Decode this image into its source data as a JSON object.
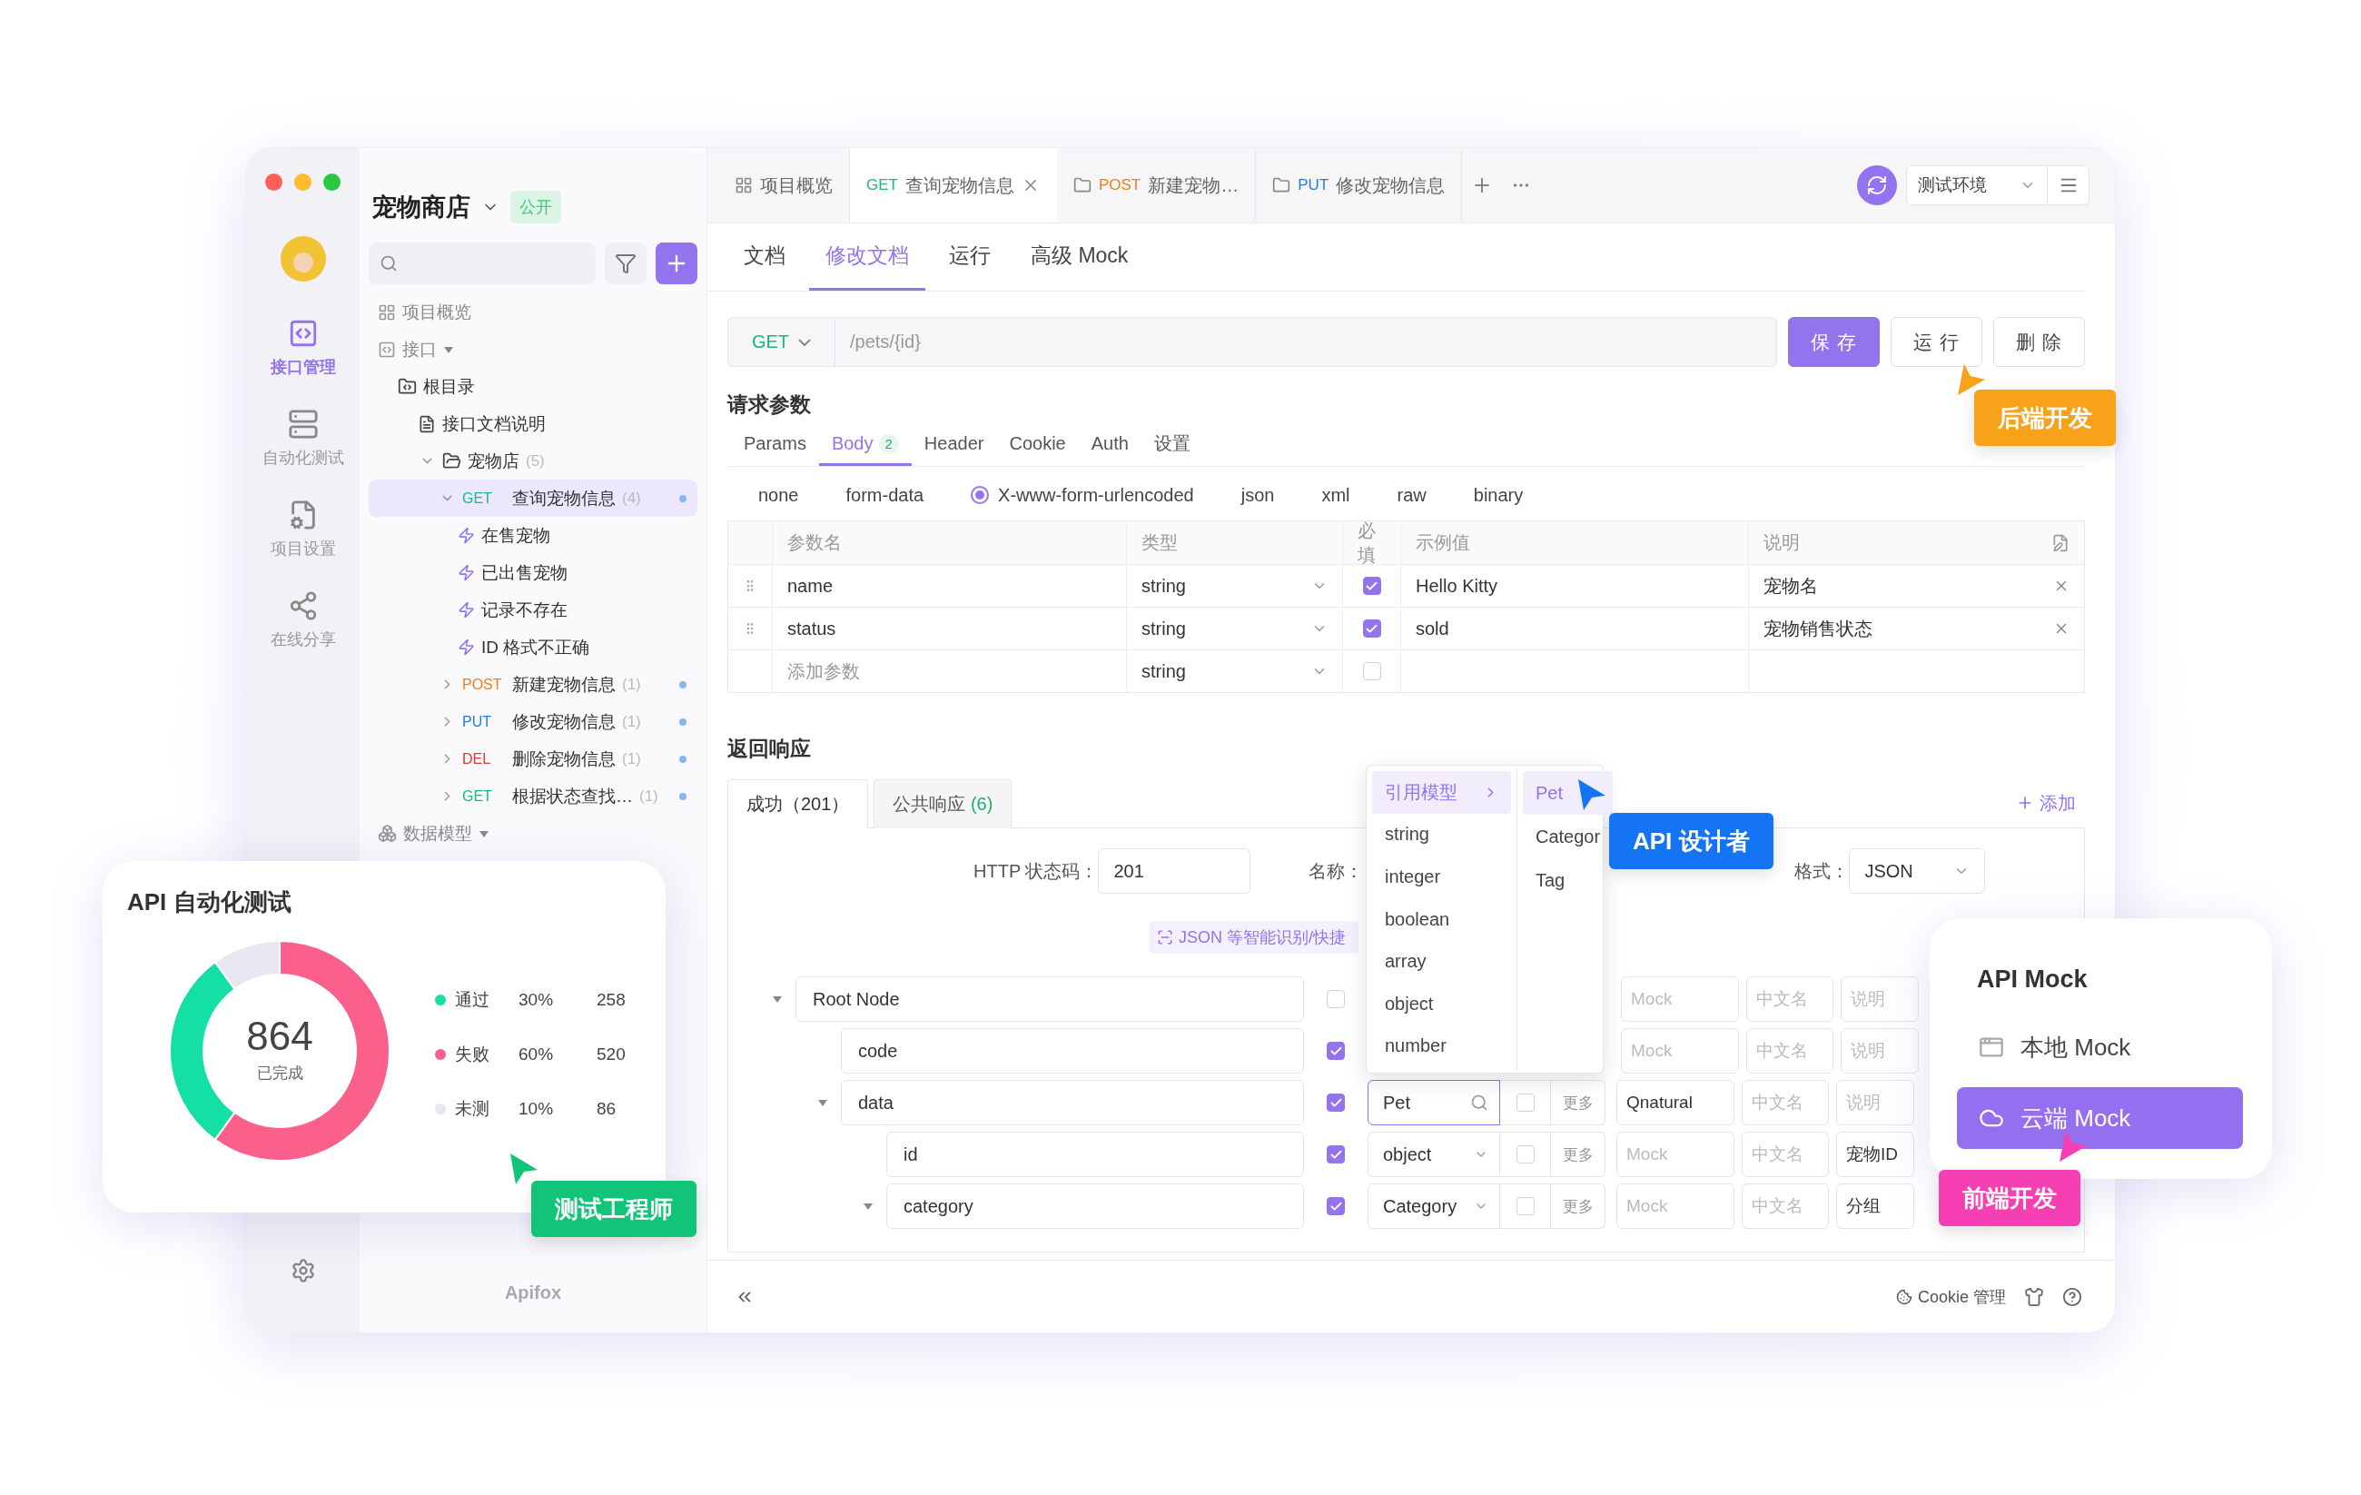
{
  "project": {
    "name": "宠物商店",
    "badge": "公开"
  },
  "rail": [
    {
      "kind": "apis",
      "label": "接口管理",
      "selected": true
    },
    {
      "kind": "automation",
      "label": "自动化测试",
      "selected": false
    },
    {
      "kind": "settings",
      "label": "项目设置",
      "selected": false
    },
    {
      "kind": "share",
      "label": "在线分享",
      "selected": false
    }
  ],
  "tree": [
    {
      "kind": "overview",
      "label": "项目概览"
    },
    {
      "kind": "apis",
      "label": "接口",
      "children": [
        {
          "kind": "root",
          "label": "根目录",
          "children": [
            {
              "kind": "doc",
              "label": "接口文档说明"
            },
            {
              "kind": "folder",
              "label": "宠物店",
              "count": "(5)",
              "expanded": true,
              "children": [
                {
                  "kind": "endpoint",
                  "method": "GET",
                  "color": "#18b97d",
                  "label": "查询宠物信息",
                  "count": "(4)",
                  "expanded": true,
                  "selected": true,
                  "children": [
                    {
                      "kind": "case",
                      "label": "在售宠物"
                    },
                    {
                      "kind": "case",
                      "label": "已出售宠物"
                    },
                    {
                      "kind": "case",
                      "label": "记录不存在"
                    },
                    {
                      "kind": "case",
                      "label": "ID 格式不正确"
                    }
                  ]
                },
                {
                  "kind": "endpoint",
                  "method": "POST",
                  "color": "#f07d1b",
                  "label": "新建宠物信息",
                  "count": "(1)",
                  "expanded": false,
                  "selected": false
                },
                {
                  "kind": "endpoint",
                  "method": "PUT",
                  "color": "#1f7fe0",
                  "label": "修改宠物信息",
                  "count": "(1)",
                  "expanded": false,
                  "selected": false
                },
                {
                  "kind": "endpoint",
                  "method": "DEL",
                  "color": "#e0362c",
                  "label": "删除宠物信息",
                  "count": "(1)",
                  "expanded": false,
                  "selected": false
                },
                {
                  "kind": "endpoint",
                  "method": "GET",
                  "color": "#18b97d",
                  "label": "根据状态查找…",
                  "count": "(1)",
                  "expanded": false,
                  "selected": false
                }
              ]
            }
          ]
        }
      ]
    },
    {
      "kind": "models",
      "label": "数据模型"
    }
  ],
  "footer_logo": "Apifox",
  "tabs": [
    {
      "kind": "overview",
      "label": "项目概览",
      "selected": false
    },
    {
      "kind": "endpoint",
      "method": "GET",
      "color": "#18b97d",
      "label": "查询宠物信息",
      "selected": true
    },
    {
      "kind": "folder",
      "method": "POST",
      "color": "#f07d1b",
      "label": "新建宠物…",
      "selected": false
    },
    {
      "kind": "folder",
      "method": "PUT",
      "color": "#1f7fe0",
      "label": "修改宠物信息",
      "selected": false
    }
  ],
  "environment": "测试环境",
  "doc_tabs": [
    {
      "label": "文档",
      "selected": false
    },
    {
      "label": "修改文档",
      "selected": true
    },
    {
      "label": "运行",
      "selected": false
    },
    {
      "label": "高级 Mock",
      "selected": false
    }
  ],
  "request": {
    "method": "GET",
    "path": "/pets/{id}",
    "buttons": [
      {
        "kind": "primary",
        "label": "保 存"
      },
      {
        "kind": "default",
        "label": "运 行"
      },
      {
        "kind": "default",
        "label": "删 除"
      }
    ]
  },
  "request_params": {
    "title": "请求参数",
    "tabs": [
      {
        "label": "Params",
        "selected": false
      },
      {
        "label": "Body",
        "badge": "2",
        "selected": true
      },
      {
        "label": "Header",
        "selected": false
      },
      {
        "label": "Cookie",
        "selected": false
      },
      {
        "label": "Auth",
        "selected": false
      },
      {
        "label": "设置",
        "selected": false
      }
    ],
    "body_types": [
      {
        "label": "none",
        "selected": false
      },
      {
        "label": "form-data",
        "selected": false
      },
      {
        "label": "X-www-form-urlencoded",
        "selected": true
      },
      {
        "label": "json",
        "selected": false
      },
      {
        "label": "xml",
        "selected": false
      },
      {
        "label": "raw",
        "selected": false
      },
      {
        "label": "binary",
        "selected": false
      }
    ],
    "columns": [
      "参数名",
      "类型",
      "必填",
      "示例值",
      "说明"
    ],
    "rows": [
      {
        "kind": "param",
        "name": "name",
        "type": "string",
        "required": true,
        "example": "Hello Kitty",
        "description": "宠物名"
      },
      {
        "kind": "param",
        "name": "status",
        "type": "string",
        "required": true,
        "example": "sold",
        "description": "宠物销售状态"
      },
      {
        "kind": "new",
        "placeholder": "添加参数",
        "type": "string",
        "required": false
      }
    ]
  },
  "response": {
    "title": "返回响应",
    "tabs": [
      {
        "label": "成功（201）",
        "selected": true
      },
      {
        "label": "公共响应",
        "count": "(6)",
        "selected": false
      }
    ],
    "add": "添加",
    "status_label": "HTTP 状态码：",
    "status": "201",
    "name_label": "名称：",
    "format_label": "格式：",
    "format": "JSON",
    "hint": "JSON 等智能识别/快捷",
    "schema": [
      {
        "name": "Root Node",
        "required": false,
        "expanded": true,
        "mock_placeholder": "Mock",
        "cn_placeholder": "中文名",
        "desc_placeholder": "说明",
        "children": [
          {
            "name": "code",
            "required": true,
            "mock_placeholder": "Mock",
            "cn_placeholder": "中文名",
            "desc_placeholder": "说明"
          },
          {
            "name": "data",
            "required": true,
            "expanded": true,
            "type": "Pet",
            "kind": "search",
            "nullable": false,
            "more": "更多",
            "mock": "Qnatural",
            "cn_placeholder": "中文名",
            "desc_placeholder": "说明",
            "children": [
              {
                "name": "id",
                "required": true,
                "type": "object",
                "kind": "select",
                "nullable": false,
                "more": "更多",
                "mock_placeholder": "Mock",
                "cn_placeholder": "中文名",
                "description": "宠物ID"
              },
              {
                "name": "category",
                "required": true,
                "expanded": true,
                "type": "Category",
                "kind": "select",
                "nullable": false,
                "more": "更多",
                "mock_placeholder": "Mock",
                "cn_placeholder": "中文名",
                "description": "分组"
              }
            ]
          }
        ]
      }
    ]
  },
  "type_menu": {
    "group": {
      "label": "引用模型",
      "selected": true
    },
    "types": [
      "string",
      "integer",
      "boolean",
      "array",
      "object",
      "number"
    ],
    "models": [
      {
        "label": "Pet",
        "selected": true
      },
      {
        "label": "Categor",
        "selected": false
      },
      {
        "label": "Tag",
        "selected": false
      }
    ]
  },
  "status_bar": {
    "cookie": "Cookie 管理"
  },
  "automation_card": {
    "title": "API 自动化测试",
    "total": "864",
    "legend": [
      {
        "percent": "30%",
        "count": "258"
      },
      {
        "percent": "60%",
        "count": "520"
      },
      {
        "percent": "10%",
        "count": "86"
      }
    ],
    "chart_data": {
      "type": "donut",
      "categories": [
        "通过",
        "失败",
        "未测"
      ],
      "series": [
        {
          "name": "已完成",
          "values": [
            30,
            60,
            10
          ]
        }
      ],
      "colors": [
        "#14dfa5",
        "#fb5f8c",
        "#e8e6f0"
      ],
      "legend": "right"
    }
  },
  "mock_card": {
    "title": "API Mock",
    "items": [
      {
        "kind": "local",
        "label": "本地 Mock",
        "selected": false
      },
      {
        "kind": "cloud",
        "label": "云端 Mock",
        "selected": true
      }
    ]
  },
  "role_badges": [
    {
      "kind": "backend",
      "label": "后端开发",
      "color": "#f8a21a"
    },
    {
      "kind": "designer",
      "label": "API 设计者",
      "color": "#1474f3"
    },
    {
      "kind": "tester",
      "label": "测试工程师",
      "color": "#12c477"
    },
    {
      "kind": "frontend",
      "label": "前端开发",
      "color": "#f63fb3"
    }
  ]
}
